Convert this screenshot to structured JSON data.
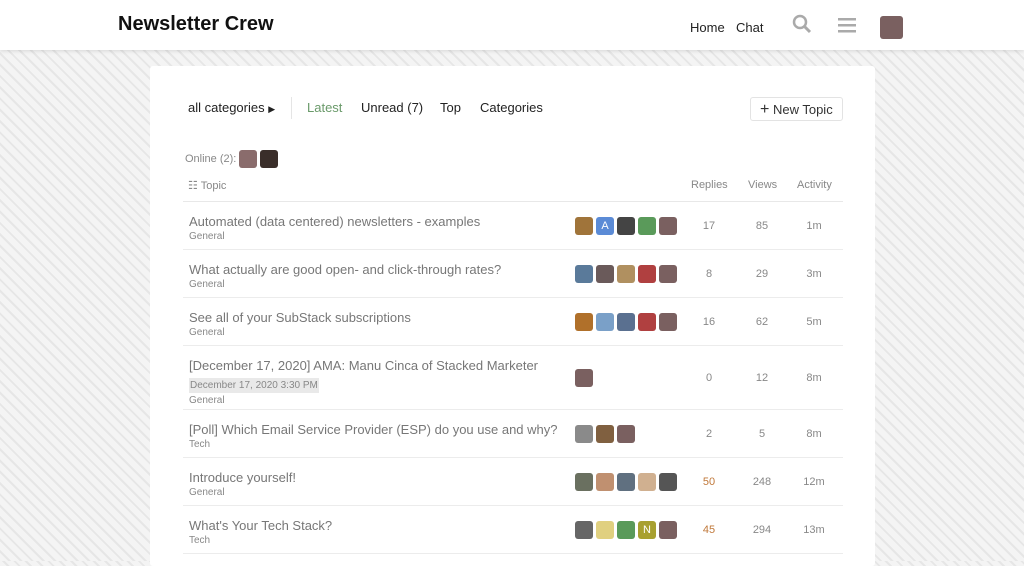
{
  "header": {
    "title": "Newsletter Crew",
    "nav": [
      "Home",
      "Chat"
    ]
  },
  "navbar": {
    "category": "all categories",
    "tabs": [
      "Latest",
      "Unread (7)",
      "Top",
      "Categories"
    ],
    "new_topic": "New Topic",
    "active_color": "#6a9a6a"
  },
  "online": {
    "label": "Online (2):",
    "avatars": [
      "#8a6c6c",
      "#3a2e2a"
    ]
  },
  "columns": {
    "topic": "Topic",
    "replies": "Replies",
    "views": "Views",
    "activity": "Activity"
  },
  "topics": [
    {
      "title": "Automated (data centered) newsletters - examples",
      "category": "General",
      "replies": "17",
      "views": "85",
      "activity": "1m",
      "hot": false,
      "avatars": [
        {
          "c": "#a0743a"
        },
        {
          "c": "#5b8bd6",
          "l": "A"
        },
        {
          "c": "#444"
        },
        {
          "c": "#5a9a5a"
        },
        {
          "c": "#7a6060"
        }
      ]
    },
    {
      "title": "What actually are good open- and click-through rates?",
      "category": "General",
      "replies": "8",
      "views": "29",
      "activity": "3m",
      "hot": false,
      "avatars": [
        {
          "c": "#5a7a9a"
        },
        {
          "c": "#6a5a5a"
        },
        {
          "c": "#b09060"
        },
        {
          "c": "#b04040"
        },
        {
          "c": "#7a6060"
        }
      ]
    },
    {
      "title": "See all of your SubStack subscriptions",
      "category": "General",
      "replies": "16",
      "views": "62",
      "activity": "5m",
      "hot": false,
      "avatars": [
        {
          "c": "#b0702a"
        },
        {
          "c": "#7aa0c8"
        },
        {
          "c": "#5a7090"
        },
        {
          "c": "#b04040"
        },
        {
          "c": "#7a6060"
        }
      ]
    },
    {
      "title": "[December 17, 2020] AMA: Manu Cinca of Stacked Marketer",
      "date": "December 17, 2020 3:30 PM",
      "category": "General",
      "replies": "0",
      "views": "12",
      "activity": "8m",
      "hot": false,
      "avatars": [
        {
          "c": "#7a6060"
        }
      ]
    },
    {
      "title": "[Poll] Which Email Service Provider (ESP) do you use and why?",
      "category": "Tech",
      "replies": "2",
      "views": "5",
      "activity": "8m",
      "hot": false,
      "avatars": [
        {
          "c": "#8a8a8a"
        },
        {
          "c": "#806040"
        },
        {
          "c": "#7a6060"
        }
      ]
    },
    {
      "title": "Introduce yourself!",
      "category": "General",
      "replies": "50",
      "views": "248",
      "activity": "12m",
      "hot": true,
      "avatars": [
        {
          "c": "#6a7060"
        },
        {
          "c": "#c09070"
        },
        {
          "c": "#607080"
        },
        {
          "c": "#d0b090"
        },
        {
          "c": "#555"
        }
      ]
    },
    {
      "title": "What's Your Tech Stack?",
      "category": "Tech",
      "replies": "45",
      "views": "294",
      "activity": "13m",
      "hot": true,
      "avatars": [
        {
          "c": "#666"
        },
        {
          "c": "#e0d080"
        },
        {
          "c": "#5a9a5a"
        },
        {
          "c": "#a8a030",
          "l": "N"
        },
        {
          "c": "#7a6060"
        }
      ]
    }
  ]
}
